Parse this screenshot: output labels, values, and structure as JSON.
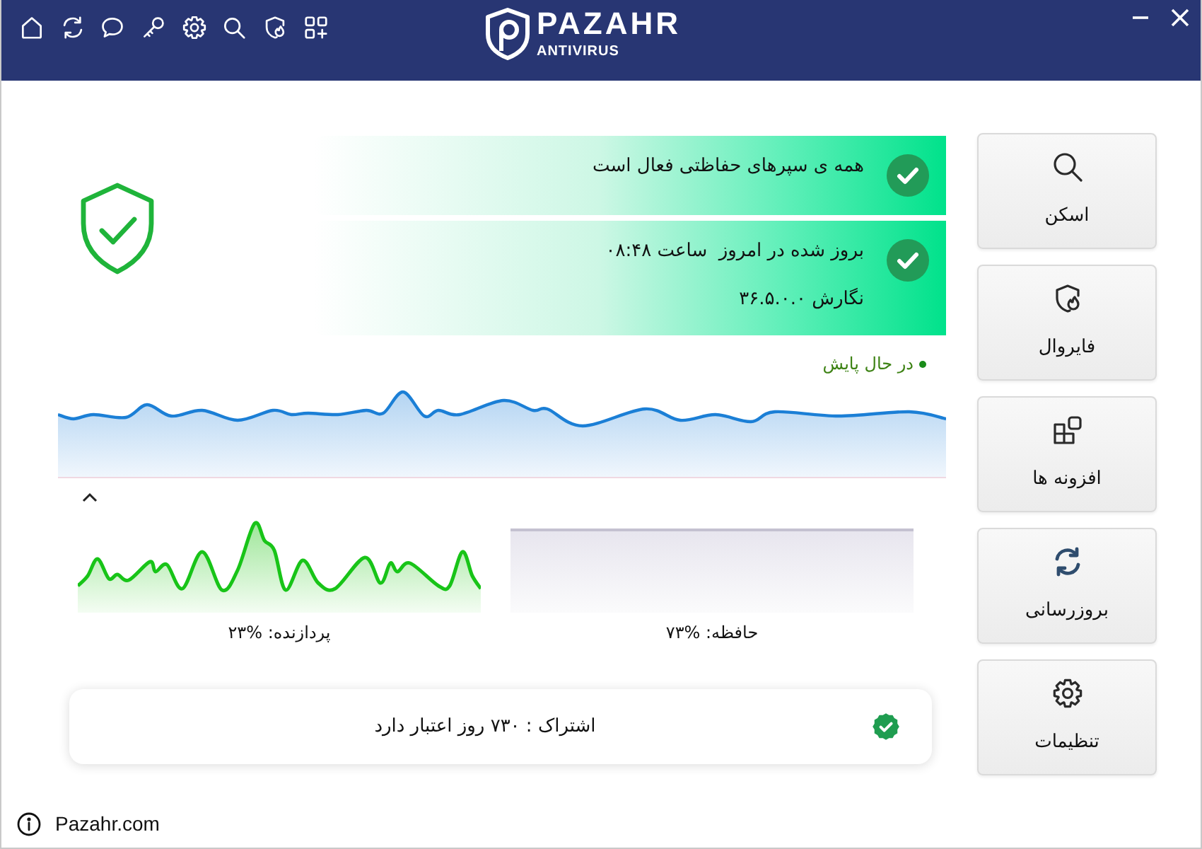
{
  "title_bar": {
    "logo": {
      "name": "PAZAHR",
      "subtitle": "ANTIVIRUS"
    }
  },
  "status_cards": [
    {
      "lines": [
        "همه ی سپرهای حفاظتی فعال است"
      ]
    },
    {
      "lines": [
        "بروز شده در امروز  ساعت ۰۸:۴۸",
        "نگارش ۳۶.۵.۰.۰"
      ]
    }
  ],
  "monitor": {
    "status": "در حال پایش"
  },
  "usage": [
    {
      "kind": "memory",
      "label": "حافظه: %۷۳"
    },
    {
      "kind": "cpu",
      "label": "پردازنده: %۲۳"
    }
  ],
  "subscription": {
    "text": "اشتراک : ۷۳۰ روز اعتبار دارد"
  },
  "sidebar": {
    "items": [
      {
        "label": "اسکن"
      },
      {
        "label": "فایروال"
      },
      {
        "label": "افزونه ها"
      },
      {
        "label": "بروزرسانی"
      },
      {
        "label": "تنظیمات"
      }
    ]
  },
  "footer": {
    "link": "Pazahr.com"
  }
}
